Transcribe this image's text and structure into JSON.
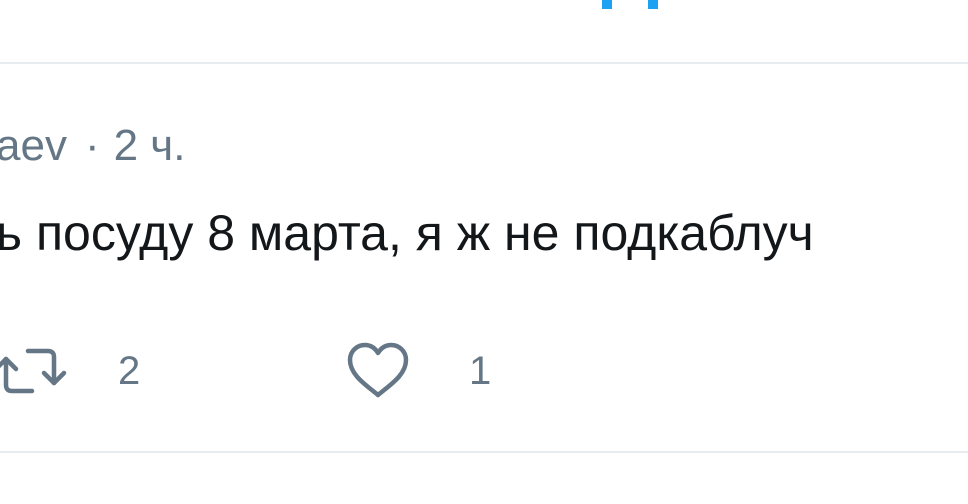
{
  "colors": {
    "accent": "#1da1f2",
    "muted": "#657786",
    "text": "#14171a",
    "divider": "#e6ecf0"
  },
  "tweet": {
    "handle_fragment": "aev",
    "separator": "·",
    "time": "2 ч.",
    "text": "ь посуду 8 марта, я ж не подкаблуч"
  },
  "actions": {
    "retweet": {
      "icon": "retweet-icon",
      "count": "2"
    },
    "like": {
      "icon": "heart-icon",
      "count": "1"
    }
  }
}
